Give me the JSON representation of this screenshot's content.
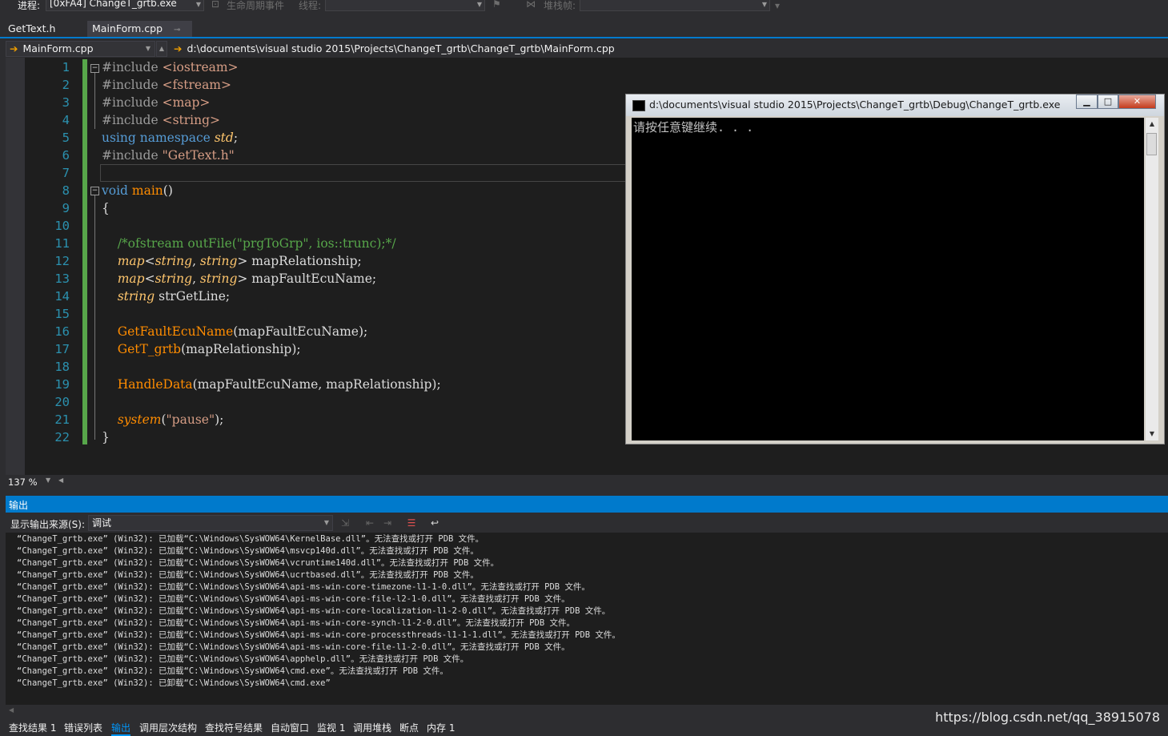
{
  "toolbar": {
    "process_label": "进程:",
    "process_value": "[0xFA4] ChangeT_grtb.exe",
    "lifecycle_label": "生命周期事件",
    "thread_label": "线程:",
    "stackframe_label": "堆栈帧:"
  },
  "tabs": [
    {
      "label": "GetText.h",
      "active": false
    },
    {
      "label": "MainForm.cpp",
      "active": true
    }
  ],
  "navbar": {
    "file_combo": "MainForm.cpp",
    "path": "d:\\documents\\visual studio 2015\\Projects\\ChangeT_grtb\\ChangeT_grtb\\MainForm.cpp"
  },
  "editor": {
    "line_numbers": [
      "1",
      "2",
      "3",
      "4",
      "5",
      "6",
      "7",
      "8",
      "9",
      "10",
      "11",
      "12",
      "13",
      "14",
      "15",
      "16",
      "17",
      "18",
      "19",
      "20",
      "21",
      "22"
    ],
    "code": {
      "l1_a": "#include ",
      "l1_b": "<iostream>",
      "l2_a": "#include ",
      "l2_b": "<fstream>",
      "l3_a": "#include ",
      "l3_b": "<map>",
      "l4_a": "#include ",
      "l4_b": "<string>",
      "l5_a": "using namespace ",
      "l5_b": "std",
      "l5_c": ";",
      "l6_a": "#include ",
      "l6_b": "\"GetText.h\"",
      "l8_a": "void ",
      "l8_b": "main",
      "l8_c": "()",
      "l9": "{",
      "l11": "    /*ofstream outFile(\"prgToGrp\", ios::trunc);*/",
      "l12_a": "    ",
      "l12_b": "map",
      "l12_c": "<",
      "l12_d": "string",
      "l12_e": ", ",
      "l12_f": "string",
      "l12_g": "> mapRelationship;",
      "l13_a": "    ",
      "l13_b": "map",
      "l13_c": "<",
      "l13_d": "string",
      "l13_e": ", ",
      "l13_f": "string",
      "l13_g": "> mapFaultEcuName;",
      "l14_a": "    ",
      "l14_b": "string",
      "l14_c": " strGetLine;",
      "l16_a": "    ",
      "l16_b": "GetFaultEcuName",
      "l16_c": "(mapFaultEcuName);",
      "l17_a": "    ",
      "l17_b": "GetT_grtb",
      "l17_c": "(mapRelationship);",
      "l19_a": "    ",
      "l19_b": "HandleData",
      "l19_c": "(mapFaultEcuName, mapRelationship);",
      "l21_a": "    ",
      "l21_b": "system",
      "l21_c": "(",
      "l21_d": "\"pause\"",
      "l21_e": ");",
      "l22": "}"
    },
    "zoom": "137 %"
  },
  "console": {
    "title": "d:\\documents\\visual studio 2015\\Projects\\ChangeT_grtb\\Debug\\ChangeT_grtb.exe",
    "text": "请按任意键继续. . ."
  },
  "output": {
    "header": "输出",
    "source_label": "显示输出来源(S):",
    "source_value": "调试",
    "lines": [
      "“ChangeT_grtb.exe” (Win32): 已加载“C:\\Windows\\SysWOW64\\KernelBase.dll”。无法查找或打开 PDB 文件。",
      "“ChangeT_grtb.exe” (Win32): 已加载“C:\\Windows\\SysWOW64\\msvcp140d.dll”。无法查找或打开 PDB 文件。",
      "“ChangeT_grtb.exe” (Win32): 已加载“C:\\Windows\\SysWOW64\\vcruntime140d.dll”。无法查找或打开 PDB 文件。",
      "“ChangeT_grtb.exe” (Win32): 已加载“C:\\Windows\\SysWOW64\\ucrtbased.dll”。无法查找或打开 PDB 文件。",
      "“ChangeT_grtb.exe” (Win32): 已加载“C:\\Windows\\SysWOW64\\api-ms-win-core-timezone-l1-1-0.dll”。无法查找或打开 PDB 文件。",
      "“ChangeT_grtb.exe” (Win32): 已加载“C:\\Windows\\SysWOW64\\api-ms-win-core-file-l2-1-0.dll”。无法查找或打开 PDB 文件。",
      "“ChangeT_grtb.exe” (Win32): 已加载“C:\\Windows\\SysWOW64\\api-ms-win-core-localization-l1-2-0.dll”。无法查找或打开 PDB 文件。",
      "“ChangeT_grtb.exe” (Win32): 已加载“C:\\Windows\\SysWOW64\\api-ms-win-core-synch-l1-2-0.dll”。无法查找或打开 PDB 文件。",
      "“ChangeT_grtb.exe” (Win32): 已加载“C:\\Windows\\SysWOW64\\api-ms-win-core-processthreads-l1-1-1.dll”。无法查找或打开 PDB 文件。",
      "“ChangeT_grtb.exe” (Win32): 已加载“C:\\Windows\\SysWOW64\\api-ms-win-core-file-l1-2-0.dll”。无法查找或打开 PDB 文件。",
      "“ChangeT_grtb.exe” (Win32): 已加载“C:\\Windows\\SysWOW64\\apphelp.dll”。无法查找或打开 PDB 文件。",
      "“ChangeT_grtb.exe” (Win32): 已加载“C:\\Windows\\SysWOW64\\cmd.exe”。无法查找或打开 PDB 文件。",
      "“ChangeT_grtb.exe” (Win32): 已卸载“C:\\Windows\\SysWOW64\\cmd.exe”"
    ]
  },
  "bottom_tabs": [
    {
      "label": "查找结果 1",
      "active": false
    },
    {
      "label": "错误列表",
      "active": false
    },
    {
      "label": "输出",
      "active": true
    },
    {
      "label": "调用层次结构",
      "active": false
    },
    {
      "label": "查找符号结果",
      "active": false
    },
    {
      "label": "自动窗口",
      "active": false
    },
    {
      "label": "监视 1",
      "active": false
    },
    {
      "label": "调用堆栈",
      "active": false
    },
    {
      "label": "断点",
      "active": false
    },
    {
      "label": "内存 1",
      "active": false
    }
  ],
  "watermark": "https://blog.csdn.net/qq_38915078"
}
